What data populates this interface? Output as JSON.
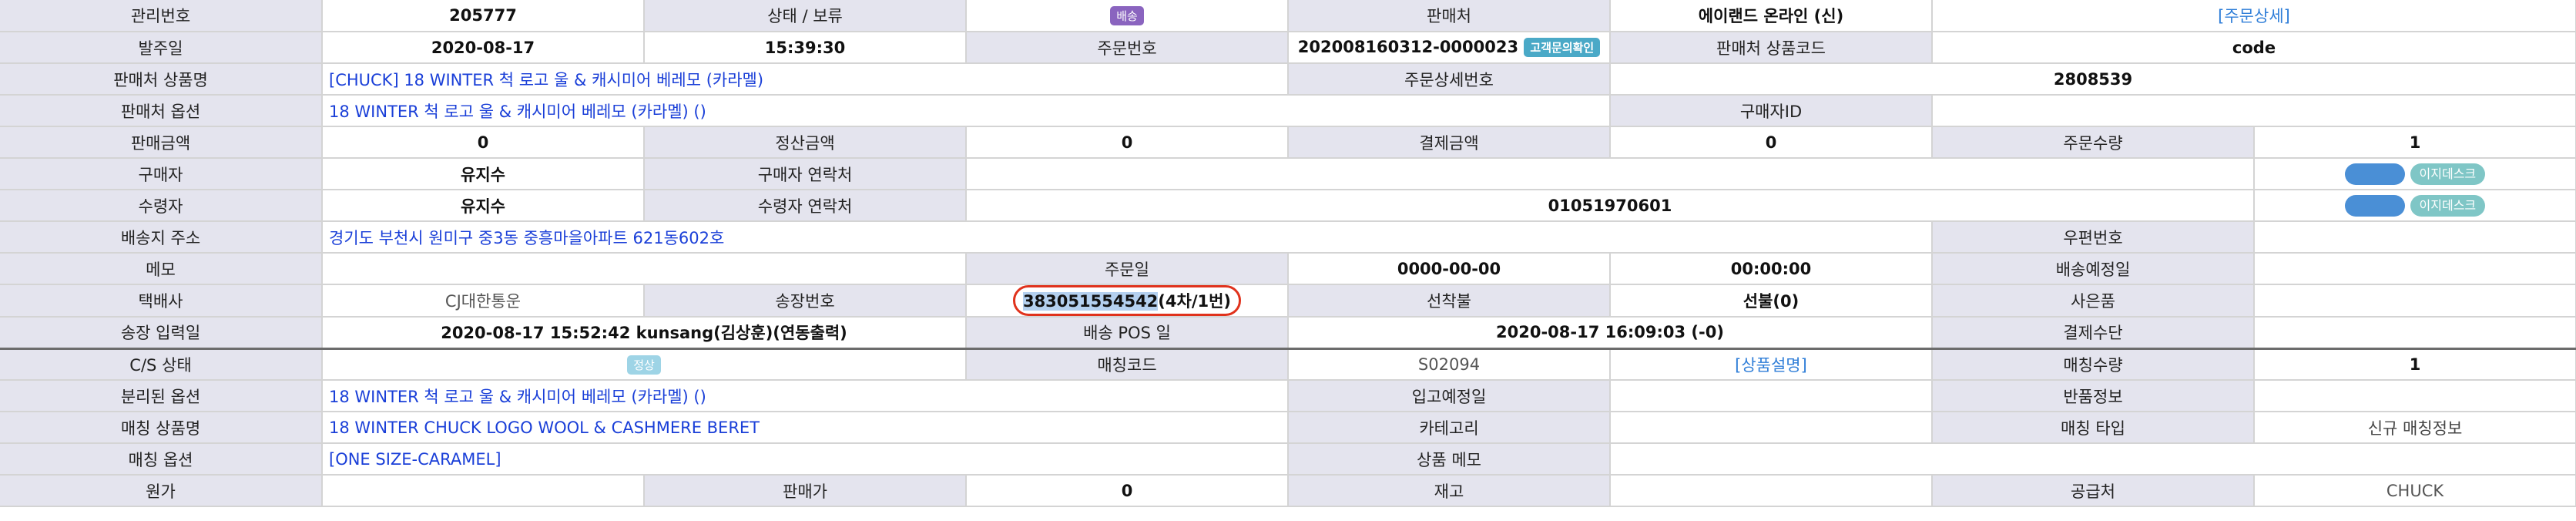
{
  "rows": {
    "r1": {
      "l1": "관리번호",
      "v1": "205777",
      "l2": "상태 / 보류",
      "badge": "배송",
      "l3": "판매처",
      "v3": "에이랜드 온라인 (신)",
      "link": "[주문상세]"
    },
    "r2": {
      "l1": "발주일",
      "v1a": "2020-08-17",
      "v1b": "15:39:30",
      "l2": "주문번호",
      "v2": "202008160312-0000023",
      "badge": "고객문의확인",
      "l3": "판매처 상품코드",
      "v3": "code"
    },
    "r3": {
      "l1": "판매처 상품명",
      "v1": "[CHUCK] 18 WINTER 척 로고 울 & 캐시미어 베레모 (카라멜)",
      "l2": "주문상세번호",
      "v2": "2808539"
    },
    "r4": {
      "l1": "판매처 옵션",
      "v1": "18 WINTER 척 로고 울 & 캐시미어 베레모 (카라멜) ()",
      "l2": "구매자ID",
      "v2": ""
    },
    "r5": {
      "l1": "판매금액",
      "v1": "0",
      "l2": "정산금액",
      "v2": "0",
      "l3": "결제금액",
      "v3": "0",
      "l4": "주문수량",
      "v4": "1"
    },
    "r6": {
      "l1": "구매자",
      "v1": "유지수",
      "l2": "구매자 연락처",
      "v2": "",
      "btn": "이지데스크"
    },
    "r7": {
      "l1": "수령자",
      "v1": "유지수",
      "l2": "수령자 연락처",
      "v2": "01051970601",
      "btn": "이지데스크"
    },
    "r8": {
      "l1": "배송지 주소",
      "v1": "경기도 부천시 원미구 중3동 중흥마을아파트 621동602호",
      "l2": "우편번호",
      "v2": ""
    },
    "r9": {
      "l1": "메모",
      "v1": "",
      "l2": "주문일",
      "v2a": "0000-00-00",
      "v2b": "00:00:00",
      "l3": "배송예정일",
      "v3": ""
    },
    "r10": {
      "l1": "택배사",
      "v1": "CJ대한통운",
      "l2": "송장번호",
      "invoice": "383051554542",
      "invoice_suffix": "(4차/1번)",
      "l3": "선착불",
      "v3": "선불(0)",
      "l4": "사은품",
      "v4": ""
    },
    "r11": {
      "l1": "송장 입력일",
      "v1": "2020-08-17 15:52:42 kunsang(김상훈)(연동출력)",
      "l2": "배송 POS 일",
      "v2": "2020-08-17 16:09:03 (-0)",
      "l3": "결제수단",
      "v3": ""
    },
    "r12": {
      "l1": "C/S 상태",
      "badge": "정상",
      "l2": "매칭코드",
      "v2": "S02094",
      "link": "[상품설명]",
      "l3": "매칭수량",
      "v3": "1"
    },
    "r13": {
      "l1": "분리된 옵션",
      "v1": "18 WINTER 척 로고 울 & 캐시미어 베레모 (카라멜) ()",
      "l2": "입고예정일",
      "v2": "",
      "l3": "반품정보",
      "v3": ""
    },
    "r14": {
      "l1": "매칭 상품명",
      "v1": "18 WINTER CHUCK LOGO WOOL & CASHMERE BERET",
      "l2": "카테고리",
      "v2": "",
      "l3": "매칭 타입",
      "v3": "신규 매칭정보"
    },
    "r15": {
      "l1": "매칭 옵션",
      "v1": "[ONE SIZE-CARAMEL]",
      "l2": "상품 메모",
      "v2": ""
    },
    "r16": {
      "l1": "원가",
      "v1": "",
      "l2": "판매가",
      "v2": "0",
      "l3": "재고",
      "v3": "",
      "l4": "공급처",
      "v4": "CHUCK"
    }
  }
}
